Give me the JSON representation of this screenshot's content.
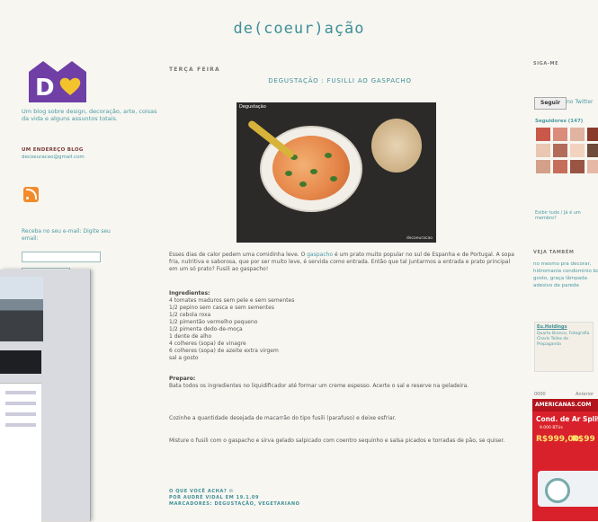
{
  "blog": {
    "title": "de(coeur)ação",
    "description": "Um blog sobre design, decoração, arte, coisas da vida e alguns assuntos totais.",
    "contact_heading": "UM ENDEREÇO BLOG",
    "contact_email": "decoeuracao@gmail.com",
    "subscribe_text": "Receba no seu e-mail: Digite seu email:"
  },
  "post": {
    "date": "TERÇA FEIRA",
    "title": "DEGUSTAÇÃO : FUSILLI AO GASPACHO",
    "photo_tag": "Degustação",
    "photo_credit": "decoeuracao",
    "intro_before_link": "Esses dias de calor pedem uma comidinha leve. O ",
    "intro_link": "gaspacho",
    "intro_after_link": " é um prato muito popular no sul de Espanha e de Portugal. A sopa fria, nutritiva e saborosa, que por ser muito leve, é servida como entrada. Então que tal juntarmos a entrada e prato principal em um só prato? Fusili ao gaspacho!",
    "ingredients_title": "Ingredientes:",
    "ingredients": [
      "4 tomates maduros sem pele e sem sementes",
      "1/2 pepino sem casca e sem sementes",
      "1/2 cebola roxa",
      "1/2 pimentão vermelho pequeno",
      "1/2 pimenta dedo-de-moça",
      "1 dente de alho",
      "4 colheres (sopa) de vinagre",
      "6 colheres (sopa) de azeite extra virgem",
      "sal a gosto"
    ],
    "prep_title": "Preparo:",
    "prep_paragraphs": [
      "Bata todos os ingredientes no liquidificador até formar um creme espesso. Acerte o sal e reserve na geladeira.",
      "Cozinhe a quantidade desejada de macarrão do tipo fusili (parafuso) e deixe esfriar.",
      "Misture o fusili com o gaspacho e sirva gelado salpicado com coentro sequinho e salsa picados e torradas de pão, se quiser."
    ],
    "footer_1": "O QUE VOCÊ ACHA?  ✉",
    "footer_2": "POR AUDRÉ VIDAL EM 19.1.09",
    "footer_3": "MARCADORES: DEGUSTAÇÃO, VEGETARIANO"
  },
  "right_sidebar": {
    "follow_heading": "SIGA-ME",
    "follow_button": "Seguir",
    "follow_link": "no Twitter",
    "followers": "Seguidores (147)",
    "see_all": "Exibir tudo / Já é um membro?",
    "see_also_heading": "VEJA TAMBÉM",
    "see_also_text": "no mesmo pra decorar, hidromania condominio bom gosto, graça lâmpada adesivo de parede",
    "badge_title": "Eu.Holdings",
    "badge_text": "Quarto Branco, Fotografia Charls Telles de Propaganda",
    "small_left": "0000",
    "small_right": "Anterior",
    "ad_brand": "AMERICANAS.COM",
    "ad_headline": "Cond. de Ar Split",
    "ad_sub": "9.000 BTUs",
    "ad_price_1": "R$999,00",
    "ad_price_2": "R$99",
    "avatar_colors": [
      "#c9584a",
      "#d98c7a",
      "#e0b4a0",
      "#8a3a2a",
      "#e9c7b2",
      "#b36b5a",
      "#f2d3c0",
      "#6e4b3a",
      "#d4a08a",
      "#c76d5b",
      "#9a5444",
      "#e6b9a6"
    ]
  },
  "colors": {
    "accent": "#3f8f98",
    "logo": "#6f3fa6",
    "heart": "#f2c32c"
  }
}
